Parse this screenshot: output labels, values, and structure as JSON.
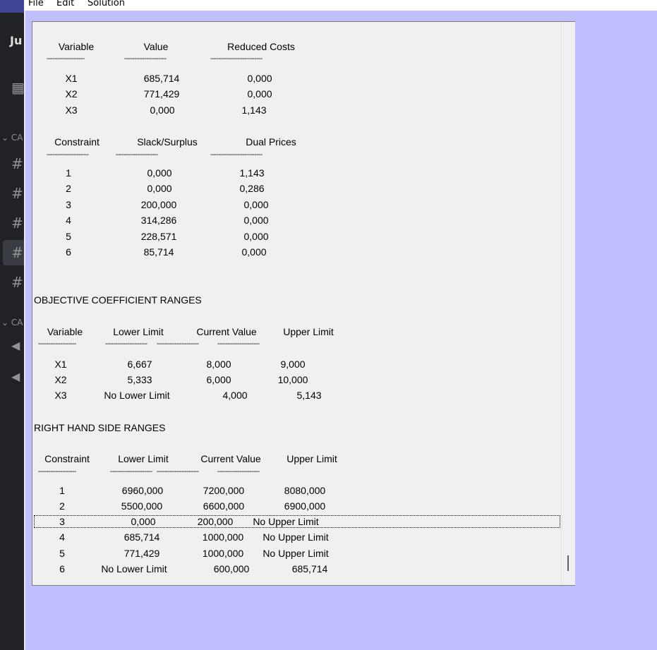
{
  "menu": [
    "File",
    "Edit",
    "Solution"
  ],
  "background_app": {
    "letters": "Ju",
    "category_prefix": "CA",
    "hash": "#"
  },
  "variables": {
    "headers": [
      "Variable",
      "Value",
      "Reduced Costs"
    ],
    "rows": [
      [
        "X1",
        "685,714",
        "0,000"
      ],
      [
        "X2",
        "771,429",
        "0,000"
      ],
      [
        "X3",
        "0,000",
        "1,143"
      ]
    ]
  },
  "constraints": {
    "headers": [
      "Constraint",
      "Slack/Surplus",
      "Dual Prices"
    ],
    "rows": [
      [
        "1",
        "0,000",
        "1,143"
      ],
      [
        "2",
        "0,000",
        "0,286"
      ],
      [
        "3",
        "200,000",
        "0,000"
      ],
      [
        "4",
        "314,286",
        "0,000"
      ],
      [
        "5",
        "228,571",
        "0,000"
      ],
      [
        "6",
        "85,714",
        "0,000"
      ]
    ]
  },
  "objective_ranges": {
    "title": "OBJECTIVE COEFFICIENT RANGES",
    "headers": [
      "Variable",
      "Lower Limit",
      "Current Value",
      "Upper Limit"
    ],
    "rows": [
      [
        "X1",
        "6,667",
        "8,000",
        "9,000"
      ],
      [
        "X2",
        "5,333",
        "6,000",
        "10,000"
      ],
      [
        "X3",
        "No Lower Limit",
        "4,000",
        "5,143"
      ]
    ]
  },
  "rhs_ranges": {
    "title": "RIGHT HAND SIDE RANGES",
    "headers": [
      "Constraint",
      "Lower Limit",
      "Current Value",
      "Upper Limit"
    ],
    "rows": [
      [
        "1",
        "6960,000",
        "7200,000",
        "8080,000"
      ],
      [
        "2",
        "5500,000",
        "6600,000",
        "6900,000"
      ],
      [
        "3",
        "0,000",
        "200,000",
        "No Upper Limit"
      ],
      [
        "4",
        "685,714",
        "1000,000",
        "No Upper Limit"
      ],
      [
        "5",
        "771,429",
        "1000,000",
        "No Upper Limit"
      ],
      [
        "6",
        "No Lower Limit",
        "600,000",
        "685,714"
      ]
    ],
    "selected_row": "3"
  },
  "colors": {
    "desktop": "#c0c0ff",
    "panel": "#f0f0f0",
    "background_app": "#202225"
  }
}
